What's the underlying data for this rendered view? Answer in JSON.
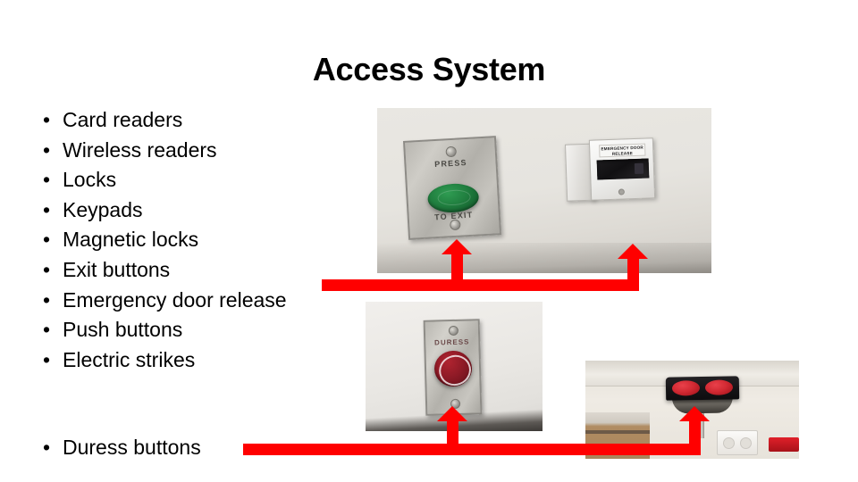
{
  "slide": {
    "title": "Access System",
    "bullet_char": "•",
    "accent_color": "#FF0000",
    "background_color": "#FFFFFF",
    "text_color": "#000000"
  },
  "bullets": [
    {
      "label": "Card readers"
    },
    {
      "label": "Wireless readers"
    },
    {
      "label": "Locks"
    },
    {
      "label": "Keypads"
    },
    {
      "label": "Magnetic locks"
    },
    {
      "label": "Exit buttons"
    },
    {
      "label": "Emergency door release"
    },
    {
      "label": "Push buttons"
    },
    {
      "label": "Electric strikes"
    }
  ],
  "trailing_bullet": {
    "label": "Duress buttons"
  },
  "photos": [
    {
      "name": "exit-button-and-emergency-door-release",
      "devices": [
        {
          "name": "press-to-exit-button",
          "label_top": "PRESS",
          "label_bottom": "TO EXIT",
          "button_color": "#207E3F"
        },
        {
          "name": "emergency-door-release-box",
          "label": "EMERGENCY DOOR RELEASE"
        }
      ]
    },
    {
      "name": "duress-button",
      "devices": [
        {
          "name": "duress-button",
          "label": "DURESS",
          "button_color": "#8E1A26"
        }
      ]
    },
    {
      "name": "ceiling-motion-sensor",
      "devices": [
        {
          "name": "dual-lens-motion-sensor",
          "lens_color": "#D22A33"
        }
      ]
    }
  ],
  "connectors": [
    {
      "name": "top-connector",
      "arrow_count": 2
    },
    {
      "name": "bottom-connector",
      "arrow_count": 2
    }
  ]
}
